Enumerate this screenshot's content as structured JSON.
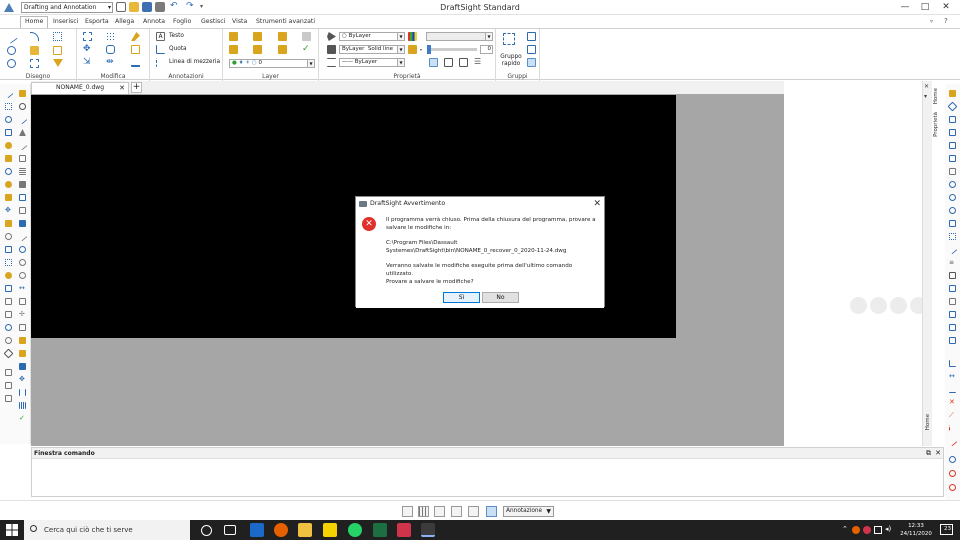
{
  "window": {
    "title": "DraftSight Standard",
    "workspace": "Drafting and Annotation",
    "controls": [
      "—",
      "□",
      "✕"
    ]
  },
  "ribbon_tabs": [
    "Home",
    "Inserisci",
    "Esporta",
    "Allega",
    "Annota",
    "Foglio",
    "Gestisci",
    "Vista",
    "Strumenti avanzati"
  ],
  "ribbon": {
    "groups": [
      "Disegno",
      "Modifica",
      "Annotazioni",
      "Layer",
      "Proprietà",
      "Gruppi"
    ],
    "annot_buttons": [
      "Testo",
      "Quota",
      "Linea di mezzeria"
    ],
    "layer_value": "0",
    "prop_color": "ByLayer",
    "prop_linetype": "ByLayer",
    "prop_linestyle": "Solid line",
    "prop_lineweight": "ByLayer",
    "transparency_value": "0",
    "group_button": "Gruppo rapido"
  },
  "document": {
    "tab_name": "NONAME_0.dwg",
    "tab_close": "✕",
    "add_tab": "+"
  },
  "side_tabs": {
    "right_top": [
      "Home",
      "Proprietà"
    ],
    "right_bottom": "Home"
  },
  "command_window": {
    "title": "Finestra comando"
  },
  "statusbar": {
    "annotation": "Annotazione"
  },
  "dialog": {
    "title": "DraftSight Avvertimento",
    "message": "Il programma verrà chiuso. Prima della chiusura del programma, provare a salvare le modifiche in:",
    "path_line1": "C:\\Program Files\\Dassault",
    "path_line2": "Systemes\\DraftSight\\bin\\NONAME_0_recover_0_2020-11-24.dwg",
    "note": "Verranno salvate le modifiche eseguite prima dell'ultimo comando utilizzato.",
    "question": "Provare a salvare le modifiche?",
    "yes": "Sì",
    "no": "No"
  },
  "taskbar": {
    "search_placeholder": "Cerca qui ciò che ti serve",
    "time": "12:33",
    "date": "24/11/2020",
    "notification_count": "23"
  },
  "colors": {
    "accent": "#0078d7",
    "canvas": "#000000",
    "error": "#e0312a",
    "taskbar": "#202020"
  }
}
